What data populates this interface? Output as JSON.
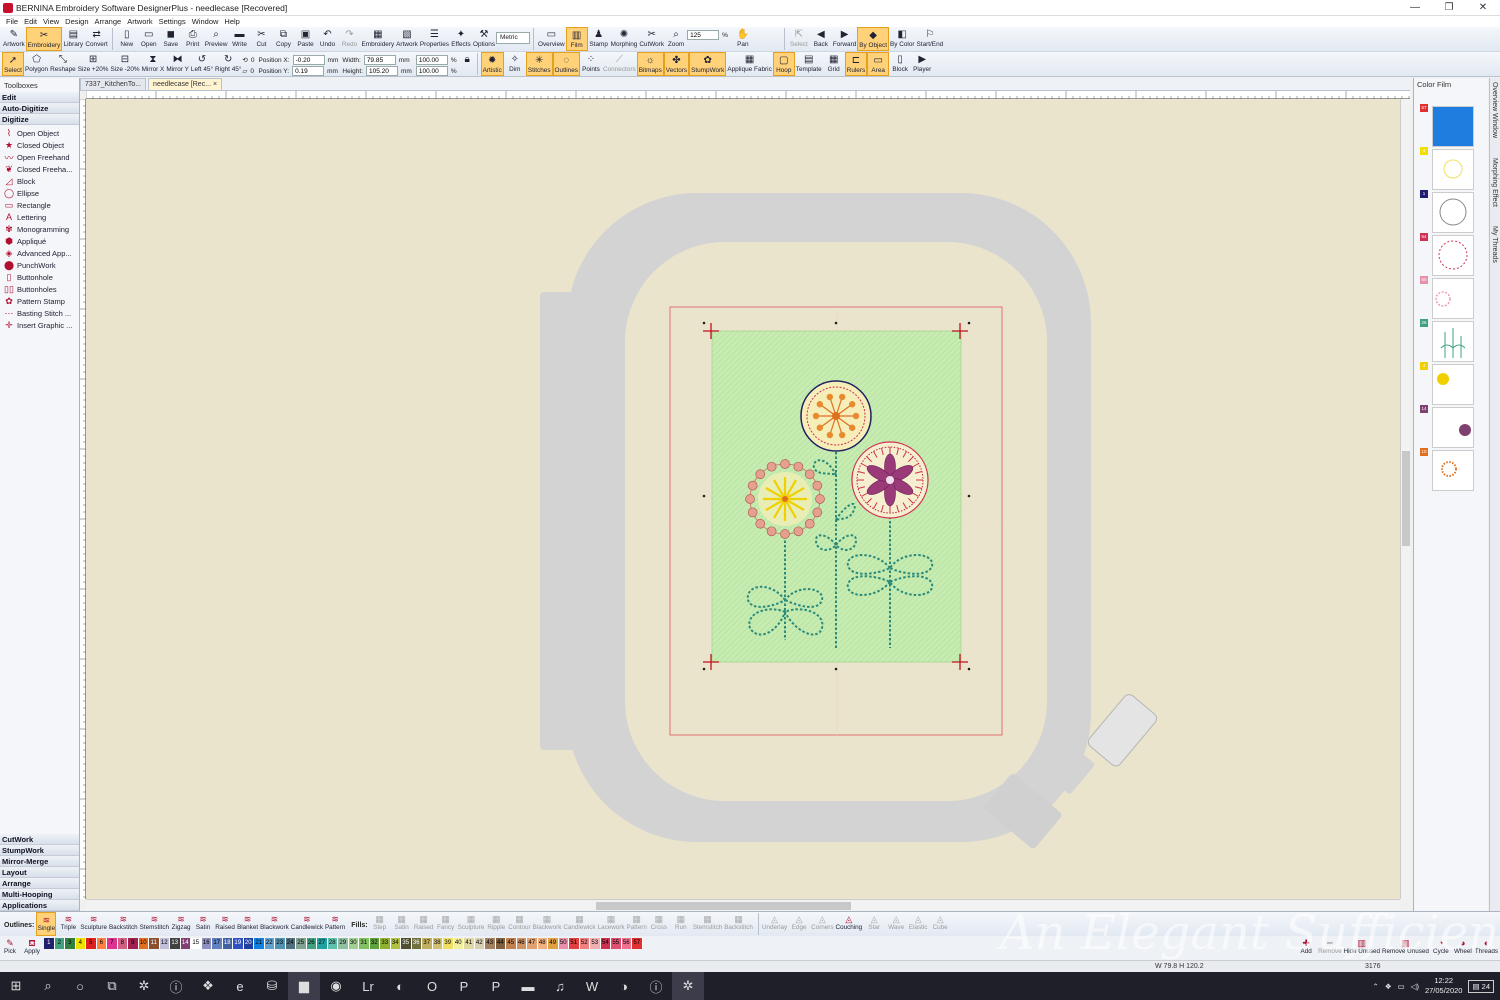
{
  "window": {
    "title": "BERNINA Embroidery Software DesignerPlus - needlecase [Recovered]",
    "min": "—",
    "max": "❐",
    "close": "✕"
  },
  "menu": [
    "File",
    "Edit",
    "View",
    "Design",
    "Arrange",
    "Artwork",
    "Settings",
    "Window",
    "Help"
  ],
  "toolbar1": {
    "group1": [
      "Artwork",
      "Embroidery",
      "Library",
      "Convert"
    ],
    "group2": [
      "New",
      "Open",
      "Save",
      "Print",
      "Preview",
      "Write",
      "Cut",
      "Copy",
      "Paste",
      "Undo",
      "Redo",
      "Embroidery",
      "Artwork",
      "Properties",
      "Effects",
      "Options"
    ],
    "units": "Metric",
    "group3": [
      "Overview",
      "Film",
      "Stamp",
      "Morphing",
      "CutWork",
      "Zoom"
    ],
    "zoom_value": "125",
    "zoom_unit": "%",
    "pan": "Pan",
    "group4": [
      "Select",
      "Back",
      "Forward",
      "By Object",
      "By Color",
      "Start/End"
    ]
  },
  "toolbar2": {
    "group1": [
      "Select",
      "Polygon",
      "Reshape",
      "Size +20%",
      "Size -20%",
      "Mirror X",
      "Mirror Y",
      "Left 45°",
      "Right 45°"
    ],
    "rotate_value": "0",
    "skew_value": "0",
    "pos_x_label": "Position X:",
    "pos_x": "-0.20",
    "pos_y_label": "Position Y:",
    "pos_y": "0.19",
    "width_label": "Width:",
    "width": "79.85",
    "height_label": "Height:",
    "height": "105.20",
    "unit_mm": "mm",
    "scale_w": "100.00",
    "scale_h": "100.00",
    "unit_pct": "%",
    "group2": [
      "Artistic",
      "Dim",
      "Stitches",
      "Outlines",
      "Points",
      "Connectors",
      "Bitmaps",
      "Vectors",
      "StumpWork",
      "Applique Fabric",
      "Hoop",
      "Template",
      "Grid",
      "Rulers",
      "Area",
      "Block",
      "Player"
    ]
  },
  "left_panel": {
    "header": "Toolboxes",
    "sections_top": [
      "Edit",
      "Auto-Digitize",
      "Digitize"
    ],
    "tools": [
      {
        "label": "Open Object",
        "icon": "open-object-icon",
        "glyph": "⌇"
      },
      {
        "label": "Closed Object",
        "icon": "closed-object-icon",
        "glyph": "★"
      },
      {
        "label": "Open Freehand",
        "icon": "open-freehand-icon",
        "glyph": "〰"
      },
      {
        "label": "Closed Freeha...",
        "icon": "closed-freehand-icon",
        "glyph": "❦"
      },
      {
        "label": "Block",
        "icon": "block-icon",
        "glyph": "◿"
      },
      {
        "label": "Ellipse",
        "icon": "ellipse-icon",
        "glyph": "◯"
      },
      {
        "label": "Rectangle",
        "icon": "rectangle-icon",
        "glyph": "▭"
      },
      {
        "label": "Lettering",
        "icon": "lettering-icon",
        "glyph": "A"
      },
      {
        "label": "Monogramming",
        "icon": "monogram-icon",
        "glyph": "✾"
      },
      {
        "label": "Appliqué",
        "icon": "applique-icon",
        "glyph": "⬢"
      },
      {
        "label": "Advanced App...",
        "icon": "advanced-applique-icon",
        "glyph": "◈"
      },
      {
        "label": "PunchWork",
        "icon": "punchwork-icon",
        "glyph": "⬤"
      },
      {
        "label": "Buttonhole",
        "icon": "buttonhole-icon",
        "glyph": "▯"
      },
      {
        "label": "Buttonholes",
        "icon": "buttonholes-icon",
        "glyph": "▯▯"
      },
      {
        "label": "Pattern Stamp",
        "icon": "pattern-stamp-icon",
        "glyph": "✿"
      },
      {
        "label": "Basting Stitch ...",
        "icon": "basting-stitch-icon",
        "glyph": "⋯"
      },
      {
        "label": "Insert Graphic ...",
        "icon": "insert-graphic-icon",
        "glyph": "✛"
      }
    ],
    "sections_bottom": [
      "CutWork",
      "StumpWork",
      "Mirror-Merge",
      "Layout",
      "Arrange",
      "Multi-Hooping",
      "Applications"
    ]
  },
  "tabs": [
    {
      "label": "7337_KitchenTo...",
      "close": ""
    },
    {
      "label": "needlecase [Rec...",
      "close": "×"
    }
  ],
  "color_film": {
    "header": "Color Film",
    "items": [
      {
        "chip": "#e03030",
        "num": "57",
        "thumb": "blue-fill"
      },
      {
        "chip": "#f0e000",
        "num": "4",
        "thumb": "yellow-flower"
      },
      {
        "chip": "#202070",
        "num": "1",
        "thumb": "circle-outline"
      },
      {
        "chip": "#d03050",
        "num": "54",
        "thumb": "red-dashed-circle"
      },
      {
        "chip": "#e890a8",
        "num": "50",
        "thumb": "pink-circle"
      },
      {
        "chip": "#40a080",
        "num": "26",
        "thumb": "teal-stems"
      },
      {
        "chip": "#f0d000",
        "num": "4",
        "thumb": "yellow-star"
      },
      {
        "chip": "#804070",
        "num": "14",
        "thumb": "purple-flower"
      },
      {
        "chip": "#e07020",
        "num": "10",
        "thumb": "orange-flower"
      }
    ]
  },
  "side_tabs": [
    "Overview Window",
    "Morphing Effect",
    "My Threads"
  ],
  "stitchbar": {
    "outlines_label": "Outlines:",
    "outlines": [
      "Single",
      "Triple",
      "Sculpture",
      "Backstitch",
      "Stemstitch",
      "Zigzag",
      "Satin",
      "Raised",
      "Blanket",
      "Blackwork",
      "Candlewick",
      "Pattern"
    ],
    "fills_label": "Fills:",
    "fills": [
      "Step",
      "Satin",
      "Raised",
      "Fancy",
      "Sculpture",
      "Ripple",
      "Contour",
      "Blackwork",
      "Candlewick",
      "Lacework",
      "Pattern",
      "Cross",
      "Run",
      "Stemstitch",
      "Backstitch"
    ],
    "extras": [
      "Underlay",
      "Edge",
      "Corners",
      "Couching",
      "Star",
      "Wave",
      "Elastic",
      "Cube"
    ]
  },
  "palette": {
    "left": [
      "Pick",
      "Apply"
    ],
    "swatches": [
      {
        "n": "1",
        "c": "#202070"
      },
      {
        "n": "2",
        "c": "#40a080"
      },
      {
        "n": "3",
        "c": "#308040"
      },
      {
        "n": "4",
        "c": "#f0e000"
      },
      {
        "n": "5",
        "c": "#e02020"
      },
      {
        "n": "6",
        "c": "#ff8040"
      },
      {
        "n": "7",
        "c": "#e03090"
      },
      {
        "n": "8",
        "c": "#d06080"
      },
      {
        "n": "9",
        "c": "#a02050"
      },
      {
        "n": "10",
        "c": "#e07020"
      },
      {
        "n": "11",
        "c": "#8a5030"
      },
      {
        "n": "12",
        "c": "#c0c0d8"
      },
      {
        "n": "13",
        "c": "#404040"
      },
      {
        "n": "14",
        "c": "#804070"
      },
      {
        "n": "15",
        "c": "#ffffff"
      },
      {
        "n": "16",
        "c": "#9090c0"
      },
      {
        "n": "17",
        "c": "#6080c0"
      },
      {
        "n": "18",
        "c": "#4060a0"
      },
      {
        "n": "19",
        "c": "#3050c0"
      },
      {
        "n": "20",
        "c": "#2040a0"
      },
      {
        "n": "21",
        "c": "#1080e0"
      },
      {
        "n": "22",
        "c": "#60a0d0"
      },
      {
        "n": "23",
        "c": "#5090b0"
      },
      {
        "n": "24",
        "c": "#507080"
      },
      {
        "n": "25",
        "c": "#80a090"
      },
      {
        "n": "26",
        "c": "#40a080"
      },
      {
        "n": "27",
        "c": "#20a0a0"
      },
      {
        "n": "28",
        "c": "#60c0b0"
      },
      {
        "n": "29",
        "c": "#90c0a0"
      },
      {
        "n": "30",
        "c": "#a0d090"
      },
      {
        "n": "31",
        "c": "#80c060"
      },
      {
        "n": "32",
        "c": "#60a040"
      },
      {
        "n": "33",
        "c": "#90b030"
      },
      {
        "n": "34",
        "c": "#b0c040"
      },
      {
        "n": "35",
        "c": "#505030"
      },
      {
        "n": "36",
        "c": "#707040"
      },
      {
        "n": "37",
        "c": "#c0b060"
      },
      {
        "n": "38",
        "c": "#d0c070"
      },
      {
        "n": "39",
        "c": "#f0e060"
      },
      {
        "n": "40",
        "c": "#f0f0a0"
      },
      {
        "n": "41",
        "c": "#e0d8a0"
      },
      {
        "n": "42",
        "c": "#d8d0b0"
      },
      {
        "n": "43",
        "c": "#a08060"
      },
      {
        "n": "44",
        "c": "#806040"
      },
      {
        "n": "45",
        "c": "#c08050"
      },
      {
        "n": "46",
        "c": "#d09060"
      },
      {
        "n": "47",
        "c": "#e0a070"
      },
      {
        "n": "48",
        "c": "#f0b080"
      },
      {
        "n": "49",
        "c": "#e0a040"
      },
      {
        "n": "50",
        "c": "#e890a8"
      },
      {
        "n": "51",
        "c": "#e04040"
      },
      {
        "n": "52",
        "c": "#f08080"
      },
      {
        "n": "53",
        "c": "#f0b0b0"
      },
      {
        "n": "54",
        "c": "#d03050"
      },
      {
        "n": "55",
        "c": "#e05070"
      },
      {
        "n": "56",
        "c": "#f07090"
      },
      {
        "n": "57",
        "c": "#e03030"
      }
    ],
    "right": [
      "Add",
      "Remove",
      "Hide Unused",
      "Remove Unused",
      "Cycle",
      "Wheel",
      "Threads"
    ]
  },
  "status": {
    "dims": "W 79.8 H 120.2",
    "count": "3176"
  },
  "taskbar": {
    "items": [
      {
        "icon": "start-icon",
        "glyph": "⊞"
      },
      {
        "icon": "search-icon",
        "glyph": "⌕"
      },
      {
        "icon": "cortana-icon",
        "glyph": "○"
      },
      {
        "icon": "task-view-icon",
        "glyph": "⧉"
      },
      {
        "icon": "settings-icon",
        "glyph": "✲"
      },
      {
        "icon": "info-icon",
        "glyph": "ⓘ"
      },
      {
        "icon": "dropbox-icon",
        "glyph": "❖"
      },
      {
        "icon": "edge-icon",
        "glyph": "e"
      },
      {
        "icon": "store-icon",
        "glyph": "⛁"
      },
      {
        "icon": "folder-icon",
        "glyph": "▆"
      },
      {
        "icon": "firefox-icon",
        "glyph": "◉"
      },
      {
        "icon": "lightroom-icon",
        "glyph": "Lr"
      },
      {
        "icon": "app-icon",
        "glyph": "◐"
      },
      {
        "icon": "outlook-icon",
        "glyph": "O"
      },
      {
        "icon": "powerpoint-icon",
        "glyph": "P"
      },
      {
        "icon": "publisher-icon",
        "glyph": "P"
      },
      {
        "icon": "sonos-icon",
        "glyph": "▬"
      },
      {
        "icon": "spotify-icon",
        "glyph": "♫"
      },
      {
        "icon": "word-icon",
        "glyph": "W"
      },
      {
        "icon": "app2-icon",
        "glyph": "◑"
      },
      {
        "icon": "info2-icon",
        "glyph": "ⓘ"
      },
      {
        "icon": "bernina-icon",
        "glyph": "✲"
      }
    ],
    "time": "12:22",
    "date": "27/05/2020",
    "notifications": "24"
  },
  "watermark": "An Elegant Sufficiency",
  "colors": {
    "accent": "#ffd27a",
    "canvas": "#ebe4cd",
    "hoop": "#d3d3d3",
    "design_bg": "#c8eab0",
    "selection": "#e07070"
  }
}
